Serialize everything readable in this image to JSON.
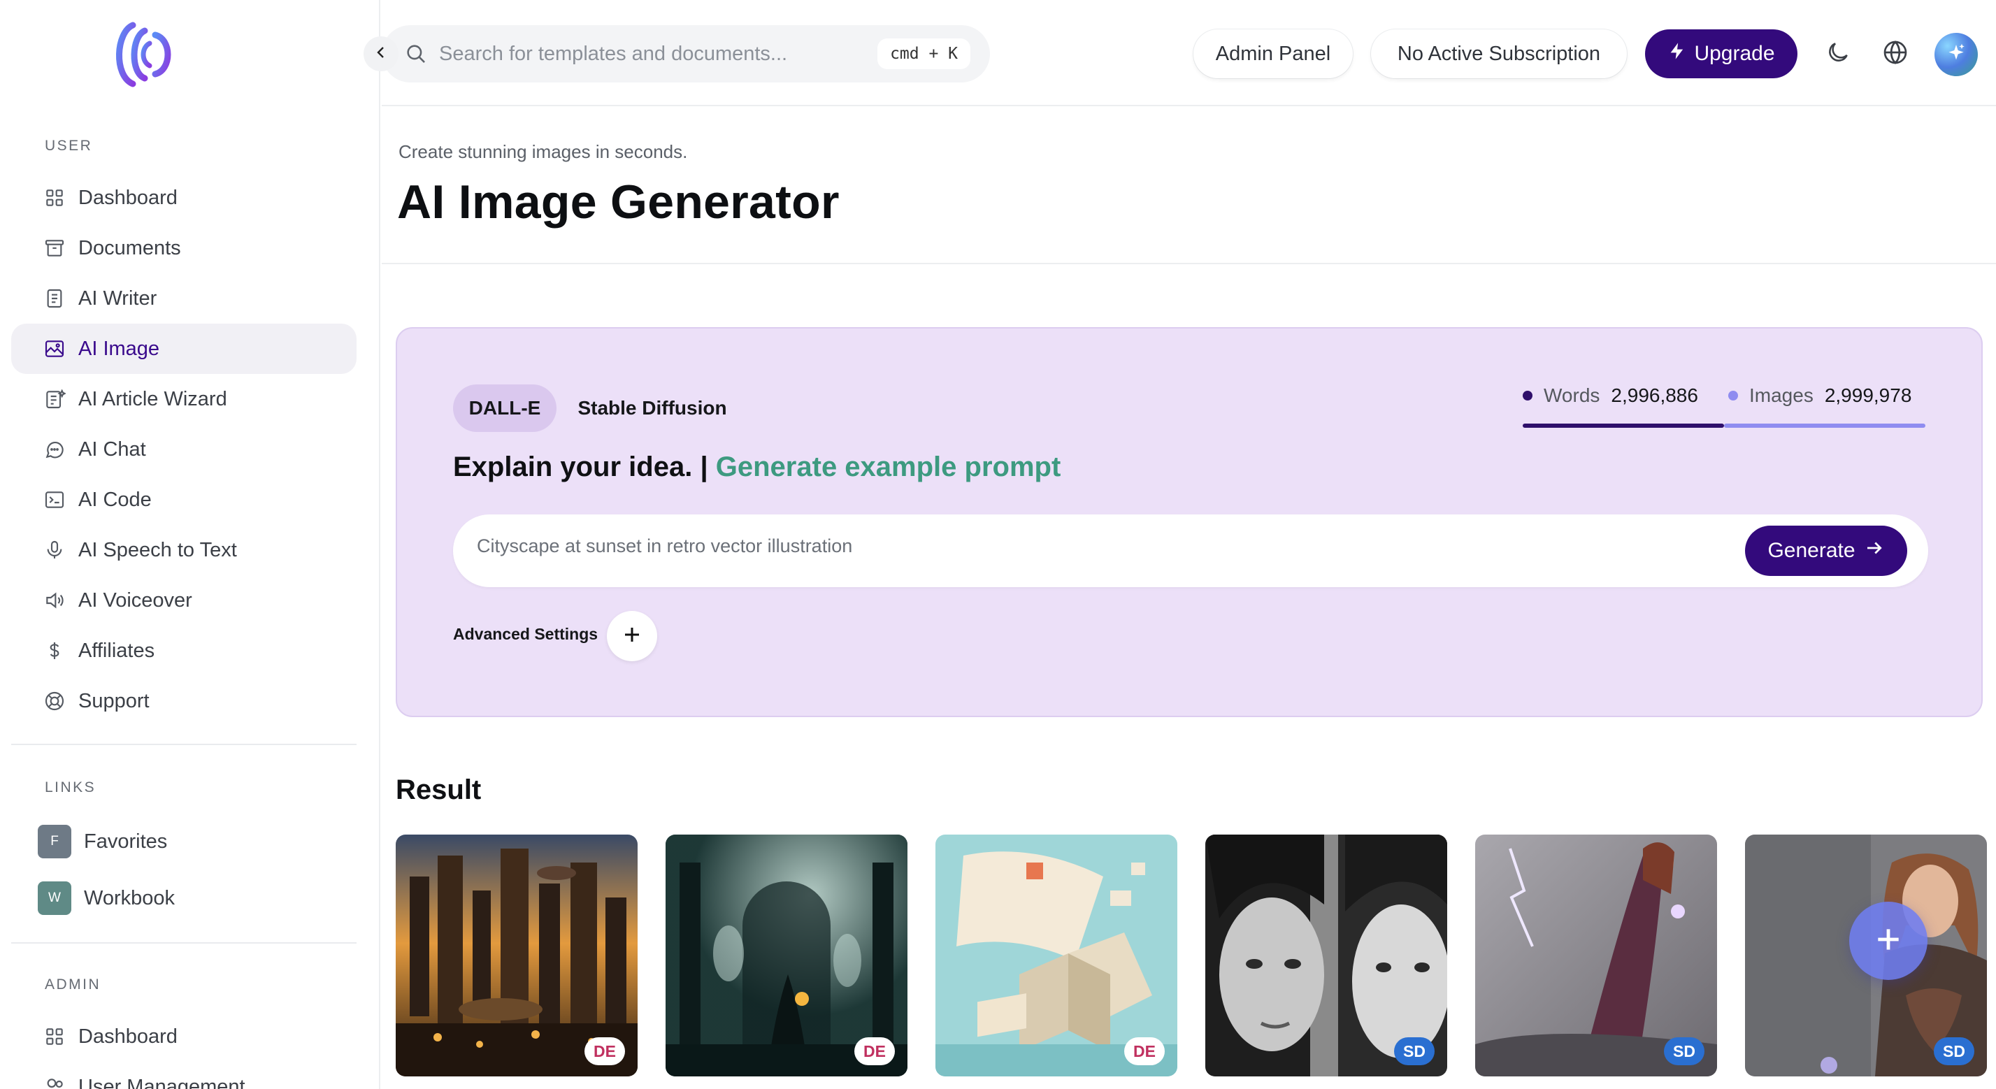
{
  "sidebar": {
    "sections": {
      "user": "User",
      "links": "Links",
      "admin": "Admin"
    },
    "user_items": [
      {
        "label": "Dashboard",
        "icon": "dashboard-icon"
      },
      {
        "label": "Documents",
        "icon": "archive-icon"
      },
      {
        "label": "AI Writer",
        "icon": "document-icon"
      },
      {
        "label": "AI Image",
        "icon": "image-icon",
        "active": true
      },
      {
        "label": "AI Article Wizard",
        "icon": "article-icon"
      },
      {
        "label": "AI Chat",
        "icon": "chat-icon"
      },
      {
        "label": "AI Code",
        "icon": "terminal-icon"
      },
      {
        "label": "AI Speech to Text",
        "icon": "microphone-icon"
      },
      {
        "label": "AI Voiceover",
        "icon": "speaker-icon"
      },
      {
        "label": "Affiliates",
        "icon": "dollar-icon"
      },
      {
        "label": "Support",
        "icon": "lifebuoy-icon"
      }
    ],
    "link_items": [
      {
        "badge": "F",
        "label": "Favorites"
      },
      {
        "badge": "W",
        "label": "Workbook"
      }
    ],
    "admin_items": [
      {
        "label": "Dashboard",
        "icon": "dashboard-icon"
      },
      {
        "label": "User Management",
        "icon": "users-icon"
      }
    ]
  },
  "topbar": {
    "search_placeholder": "Search for templates and documents...",
    "shortcut": "cmd + K",
    "admin_panel": "Admin Panel",
    "subscription": "No Active Subscription",
    "upgrade": "Upgrade"
  },
  "header": {
    "subtitle": "Create stunning images in seconds.",
    "title": "AI Image Generator"
  },
  "generator": {
    "engines": [
      "DALL-E",
      "Stable Diffusion"
    ],
    "active_engine": "DALL-E",
    "stats": {
      "words_label": "Words",
      "words_value": "2,996,886",
      "images_label": "Images",
      "images_value": "2,999,978"
    },
    "prompt_heading": "Explain your idea. |",
    "generate_example": "Generate example prompt",
    "prompt_placeholder": "Cityscape at sunset in retro vector illustration",
    "generate_button": "Generate",
    "advanced_settings": "Advanced Settings"
  },
  "results": {
    "title": "Result",
    "images": [
      {
        "tag": "DE",
        "subject": "steampunk city with airships"
      },
      {
        "tag": "DE",
        "subject": "ghostly gothic hall with lantern"
      },
      {
        "tag": "DE",
        "subject": "isometric paper documents"
      },
      {
        "tag": "SD",
        "subject": "black and white portrait of two women"
      },
      {
        "tag": "SD",
        "subject": "sorceress with lightning"
      },
      {
        "tag": "SD",
        "subject": "sorceress portrait"
      }
    ]
  },
  "colors": {
    "brand": "#330a7c",
    "card_bg": "#ece0f8",
    "accent_green": "#3d9a80",
    "words_dot": "#2f0f6b",
    "images_dot": "#8f8cf0"
  }
}
